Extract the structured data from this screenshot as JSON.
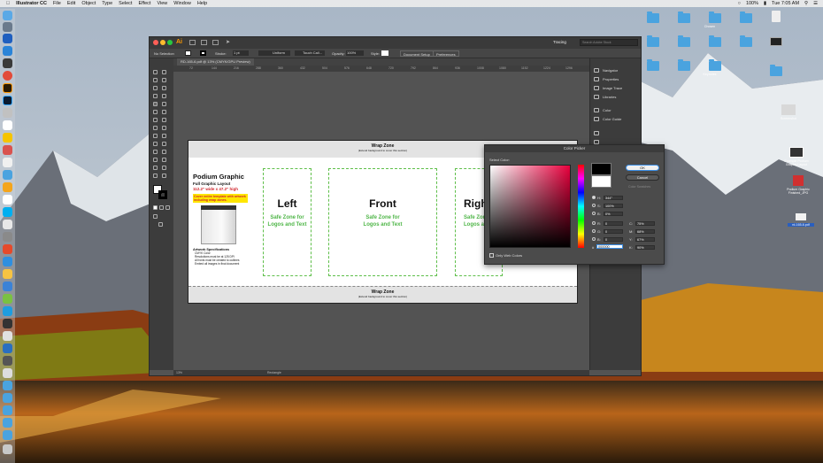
{
  "menubar": {
    "apple": "",
    "app_name": "Illustrator CC",
    "items": [
      "File",
      "Edit",
      "Object",
      "Type",
      "Select",
      "Effect",
      "View",
      "Window",
      "Help"
    ],
    "battery": "100%",
    "clock": "Tue 7:05 AM"
  },
  "desktop": {
    "icons": [
      {
        "label": ""
      },
      {
        "label": ""
      },
      {
        "label": "Chosen"
      },
      {
        "label": ""
      },
      {
        "label": ""
      },
      {
        "label": ""
      },
      {
        "label": ""
      },
      {
        "label": ""
      },
      {
        "label": ""
      },
      {
        "label": ""
      },
      {
        "label": ""
      },
      {
        "label": "Keynotes"
      },
      {
        "label": ""
      },
      {
        "label": "Screenshot"
      }
    ],
    "file_labels": [
      "Example Podium Graphic Layout",
      "Podium Graphic Finished_JPG",
      "rd-165-6.pdf"
    ]
  },
  "window": {
    "title_ai": "Ai",
    "workspace": "Tracing",
    "search_placeholder": "Search Adobe Stock",
    "control": {
      "selection": "No Selection",
      "stroke_label": "Stroke:",
      "stroke_value": "1 pt",
      "uniform": "Uniform",
      "brush": "Touch Call...",
      "opacity_label": "Opacity:",
      "opacity_value": "100%",
      "style_label": "Style:",
      "doc_setup": "Document Setup",
      "preferences": "Preferences"
    },
    "tab": "RD-165-6.pdf @ 13% (CMYK/GPU Preview)",
    "ruler_ticks": [
      "72",
      "144",
      "216",
      "288",
      "360",
      "432",
      "504",
      "576",
      "648",
      "720",
      "792",
      "864",
      "936",
      "1008",
      "1080",
      "1152",
      "1224",
      "1296"
    ],
    "status_zoom": "13%",
    "status_tool": "Rectangle"
  },
  "panels": {
    "items": [
      "Navigator",
      "Properties",
      "Image Trace",
      "Libraries",
      "Color",
      "Color Guide"
    ]
  },
  "artboard": {
    "wrap_top_title": "Wrap Zone",
    "wrap_top_sub": "(Extend background to cover this section)",
    "wrap_bottom_title": "Wrap Zone",
    "wrap_bottom_sub": "(Extend background to cover this section)",
    "heading": "Podium Graphic",
    "subheading": "Full Graphic Layout",
    "size": "112.2\" wide x 47.2\" high",
    "note": "Cover entire template with artwork including wrap zones.",
    "spec_title": "Artwork Specifications",
    "specs": [
      "CMYK Color",
      "Resolutions must be at 125 DPI",
      "All fonts must be created to outlines",
      "Embed all images in final document"
    ],
    "panels": [
      {
        "name": "Left",
        "sub1": "Safe Zone for",
        "sub2": "Logos and Text"
      },
      {
        "name": "Front",
        "sub1": "Safe Zone for",
        "sub2": "Logos and Text"
      },
      {
        "name": "Righ",
        "sub1": "Safe Zone",
        "sub2": "Logos and"
      }
    ]
  },
  "color_picker": {
    "title": "Color Picker",
    "select_label": "Select Color:",
    "ok": "OK",
    "cancel": "Cancel",
    "swatches": "Color Swatches",
    "only_web": "Only Web Colors",
    "fields": {
      "H": "344°",
      "S": "100%",
      "B": "0%",
      "R": "0",
      "G": "0",
      "Bl": "0",
      "hex": "000000",
      "C": "75%",
      "M": "68%",
      "Y": "67%",
      "K": "90%"
    }
  }
}
